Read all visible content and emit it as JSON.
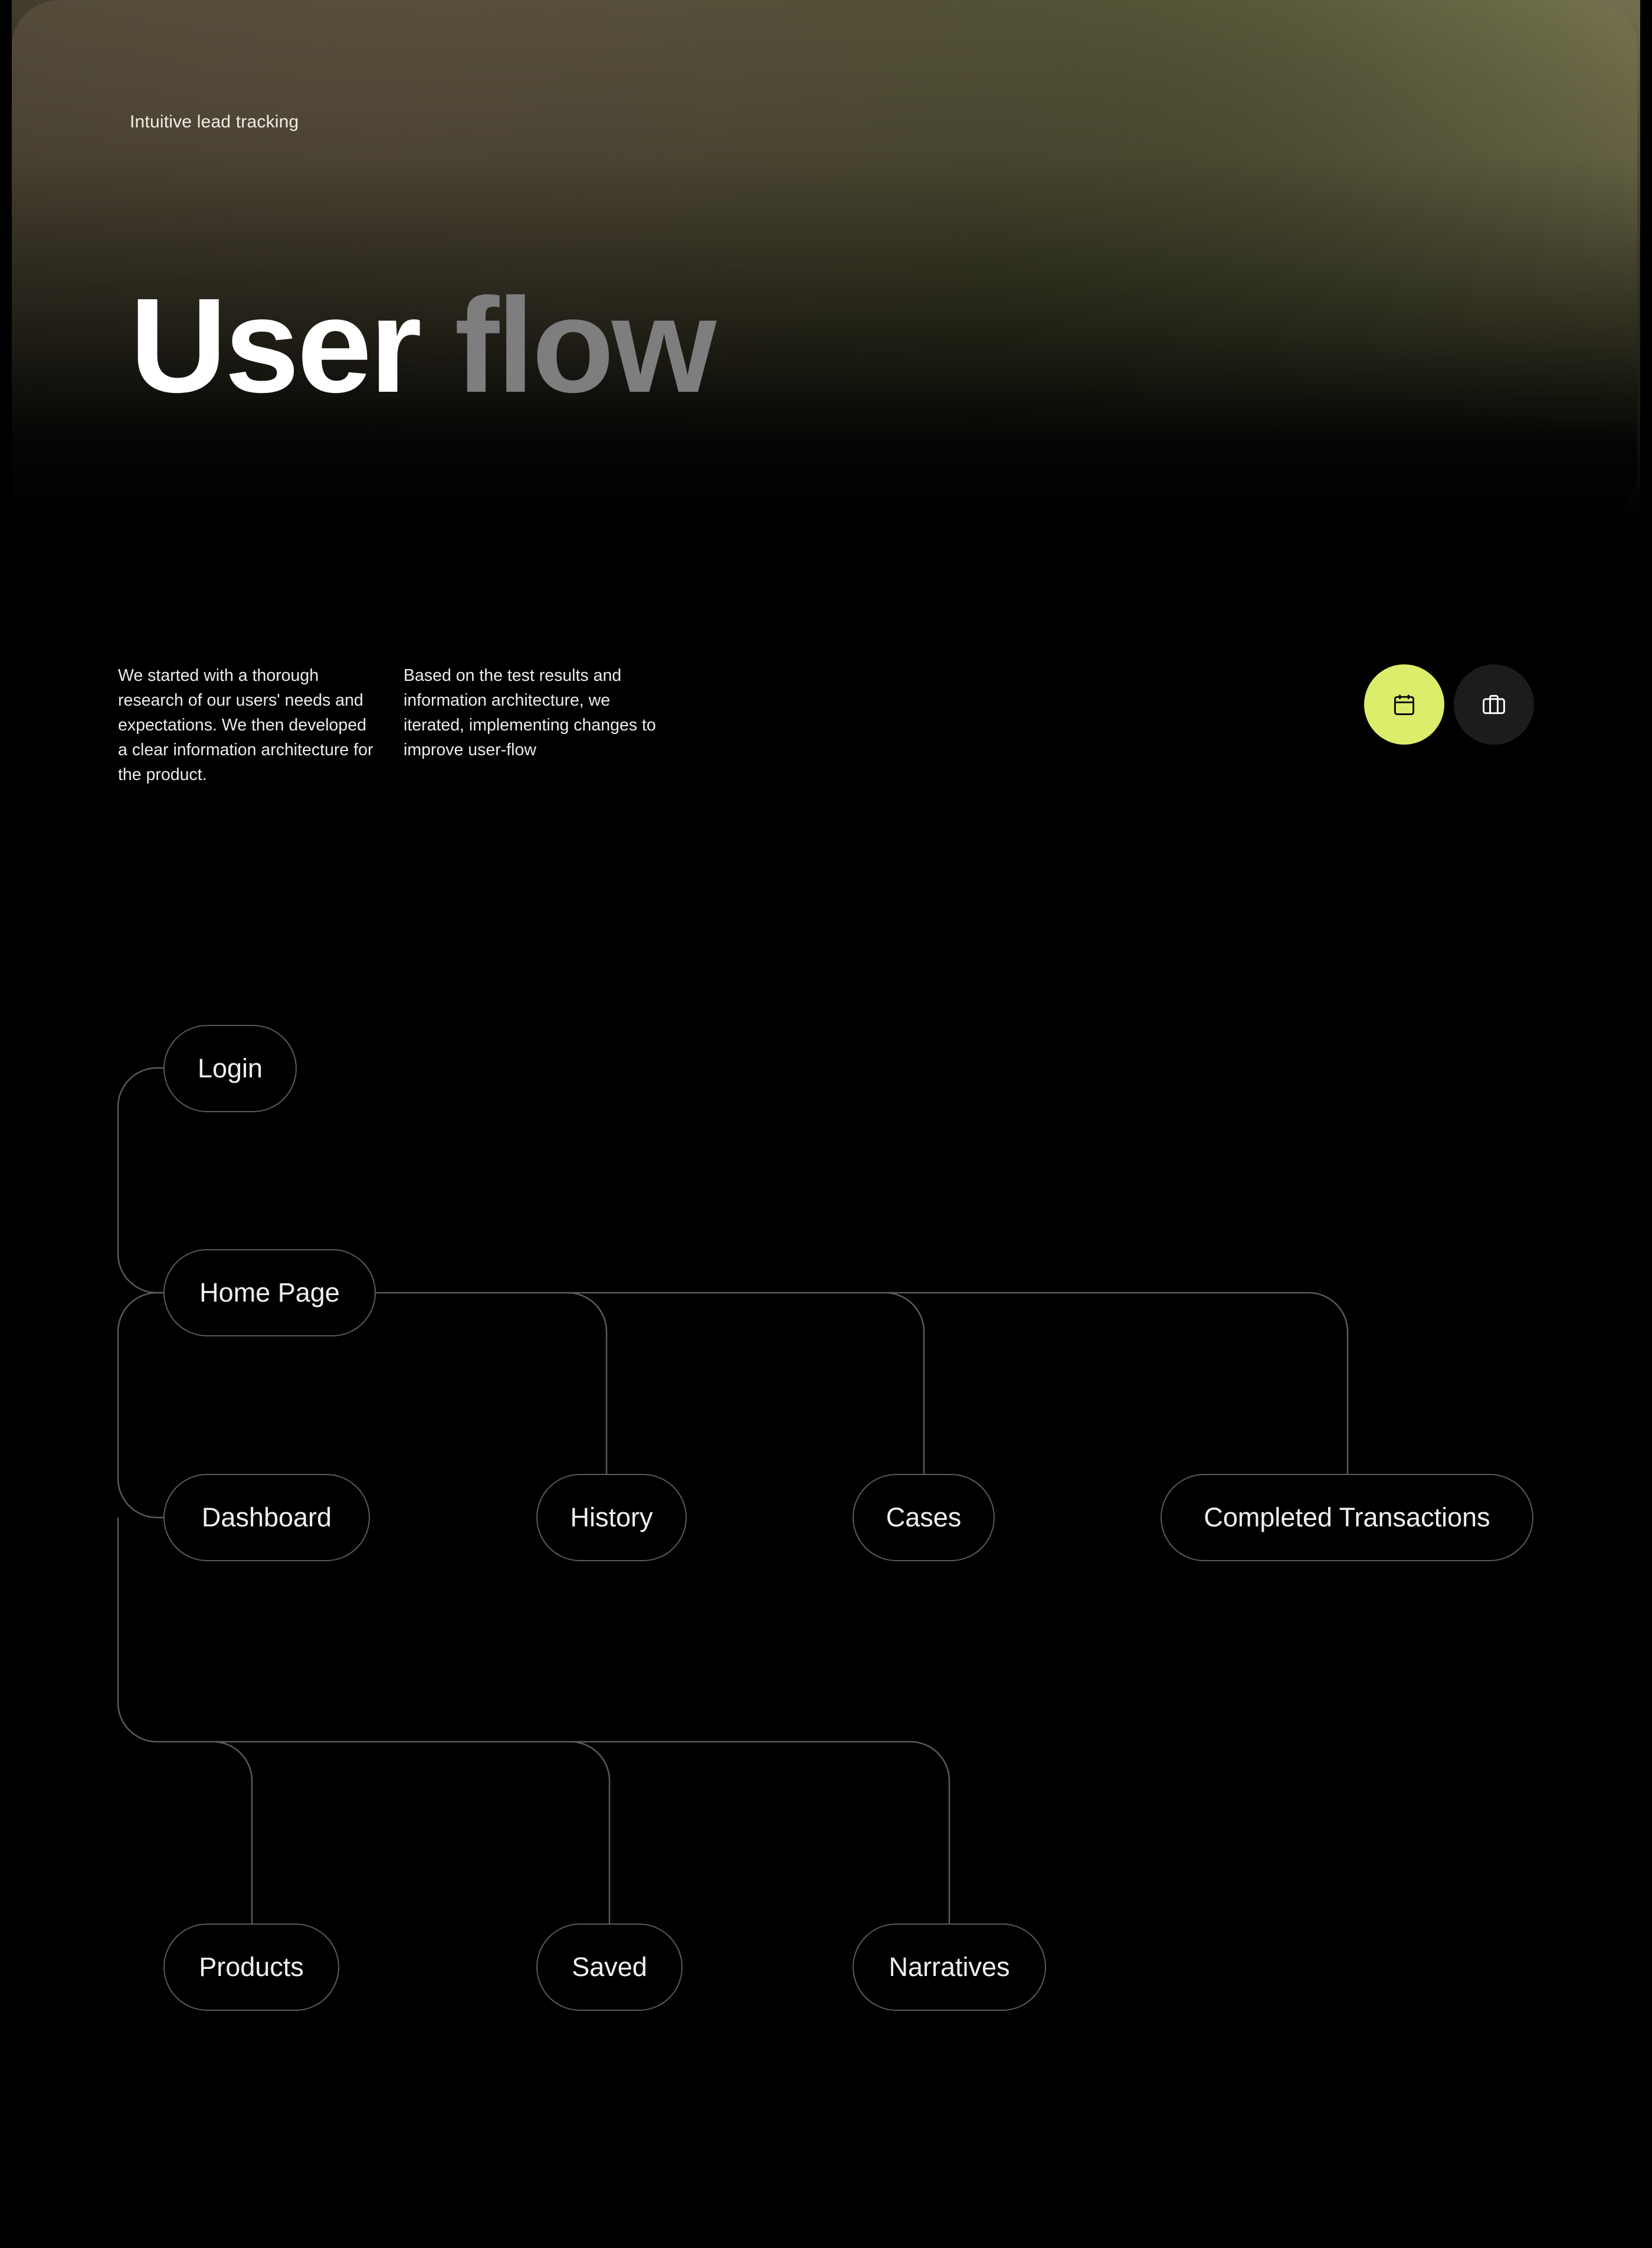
{
  "hero": {
    "kicker": "Intuitive lead tracking",
    "title_word_1": "User",
    "title_word_2": "flow"
  },
  "intro": {
    "left_paragraph": "We started with a thorough research of our users' needs and expectations. We then developed a clear information architecture for the product.",
    "right_paragraph": "Based on the test results and information architecture, we iterated, implementing changes to improve user-flow"
  },
  "view_toggle": {
    "buttons": [
      {
        "icon": "calendar-icon",
        "active": true
      },
      {
        "icon": "briefcase-icon",
        "active": false
      }
    ]
  },
  "colors": {
    "accent": "#dbed6a",
    "background": "#000000",
    "connector": "#5a5a5a",
    "muted_title": "#7e7e7e",
    "inactive_button": "#1c1c1c"
  },
  "flow": {
    "nodes": [
      {
        "id": "login",
        "label": "Login",
        "primary": false
      },
      {
        "id": "home",
        "label": "Home Page",
        "primary": true
      },
      {
        "id": "dashboard",
        "label": "Dashboard",
        "primary": false
      },
      {
        "id": "history",
        "label": "History",
        "primary": false
      },
      {
        "id": "cases",
        "label": "Cases",
        "primary": false
      },
      {
        "id": "completed",
        "label": "Completed Transactions",
        "primary": false
      },
      {
        "id": "products",
        "label": "Products",
        "primary": false
      },
      {
        "id": "saved",
        "label": "Saved",
        "primary": false
      },
      {
        "id": "narratives",
        "label": "Narratives",
        "primary": false
      }
    ],
    "edges": [
      {
        "from": "login",
        "to": "home"
      },
      {
        "from": "home",
        "to": "dashboard"
      },
      {
        "from": "home",
        "to": "history"
      },
      {
        "from": "home",
        "to": "cases"
      },
      {
        "from": "home",
        "to": "completed"
      },
      {
        "from": "home",
        "to": "products"
      },
      {
        "from": "home",
        "to": "saved"
      },
      {
        "from": "home",
        "to": "narratives"
      }
    ]
  }
}
